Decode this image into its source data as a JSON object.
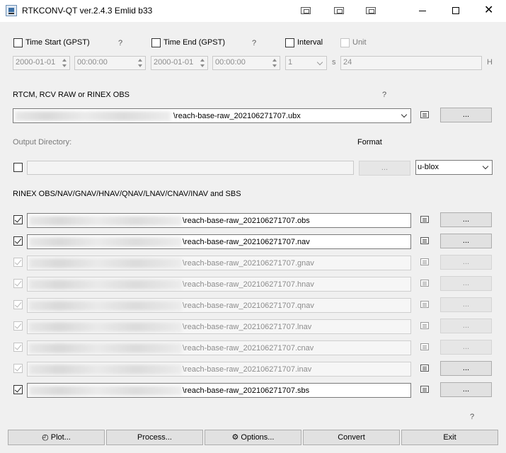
{
  "window": {
    "title": "RTKCONV-QT ver.2.4.3 Emlid b33",
    "close_glyph": "✕"
  },
  "time": {
    "start_label": "Time Start (GPST)",
    "start_help": "?",
    "start_date": "2000-01-01",
    "start_time": "00:00:00",
    "end_label": "Time End (GPST)",
    "end_help": "?",
    "end_date": "2000-01-01",
    "end_time": "00:00:00",
    "interval_label": "Interval",
    "interval_value": "1",
    "interval_unit": "s",
    "unit_label": "Unit",
    "unit_value": "24",
    "unit_suffix": "H"
  },
  "input": {
    "label": "RTCM, RCV RAW or RINEX OBS",
    "help": "?",
    "file": "\\reach-base-raw_202106271707.ubx",
    "browse": "..."
  },
  "output": {
    "dir_label": "Output Directory:",
    "dir_value": "",
    "dir_browse": "...",
    "format_label": "Format",
    "format_value": "u-blox"
  },
  "rinex": {
    "label": "RINEX OBS/NAV/GNAV/HNAV/QNAV/LNAV/CNAV/INAV and SBS",
    "files": [
      {
        "file": "\\reach-base-raw_202106271707.obs",
        "browse": "..."
      },
      {
        "file": "\\reach-base-raw_202106271707.nav",
        "browse": "..."
      },
      {
        "file": "\\reach-base-raw_202106271707.gnav",
        "browse": "..."
      },
      {
        "file": "\\reach-base-raw_202106271707.hnav",
        "browse": "..."
      },
      {
        "file": "\\reach-base-raw_202106271707.qnav",
        "browse": "..."
      },
      {
        "file": "\\reach-base-raw_202106271707.lnav",
        "browse": "..."
      },
      {
        "file": "\\reach-base-raw_202106271707.cnav",
        "browse": "..."
      },
      {
        "file": "\\reach-base-raw_202106271707.inav",
        "browse": "..."
      },
      {
        "file": "\\reach-base-raw_202106271707.sbs",
        "browse": "..."
      }
    ]
  },
  "footer": {
    "help": "?",
    "plot": "Plot...",
    "plot_glyph": "◴",
    "process": "Process...",
    "options": "Options...",
    "options_glyph": "⚙",
    "convert": "Convert",
    "exit": "Exit"
  }
}
